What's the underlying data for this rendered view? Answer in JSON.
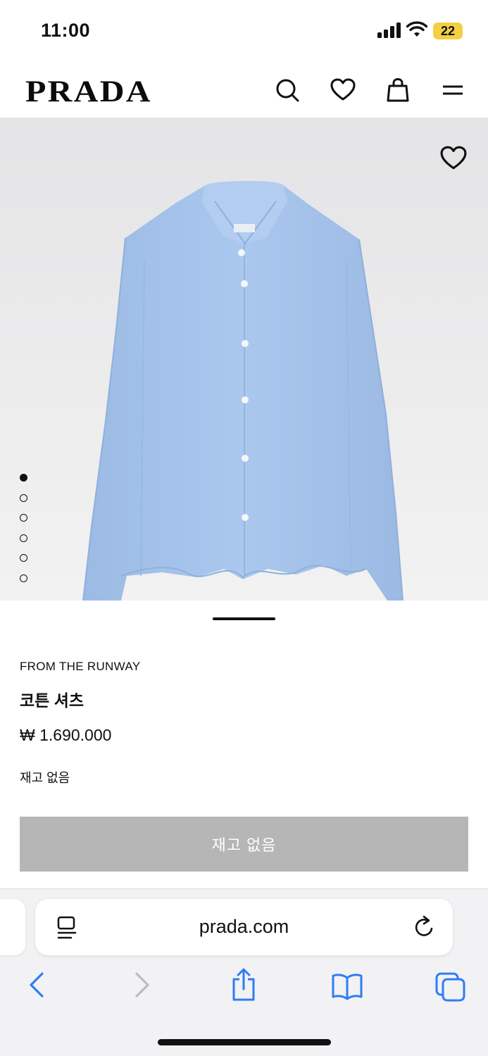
{
  "status_bar": {
    "time": "11:00",
    "battery": "22"
  },
  "header": {
    "logo": "PRADA",
    "icons": [
      "search-icon",
      "heart-icon",
      "bag-icon",
      "menu-icon"
    ]
  },
  "gallery": {
    "total_images": 6,
    "active_index": 0
  },
  "product": {
    "category": "FROM THE RUNWAY",
    "name": "코튼 셔츠",
    "price": "₩ 1.690.000",
    "stock_status": "재고 없음",
    "button_label": "재고 없음"
  },
  "browser": {
    "url": "prada.com",
    "toolbar": [
      "back-icon",
      "forward-icon",
      "share-icon",
      "bookmarks-icon",
      "tabs-icon"
    ]
  },
  "colors": {
    "accent": "#2f7cf6",
    "disabled_button": "#b6b6b6",
    "battery": "#f4cf43",
    "shirt": "#a8c6ec"
  }
}
